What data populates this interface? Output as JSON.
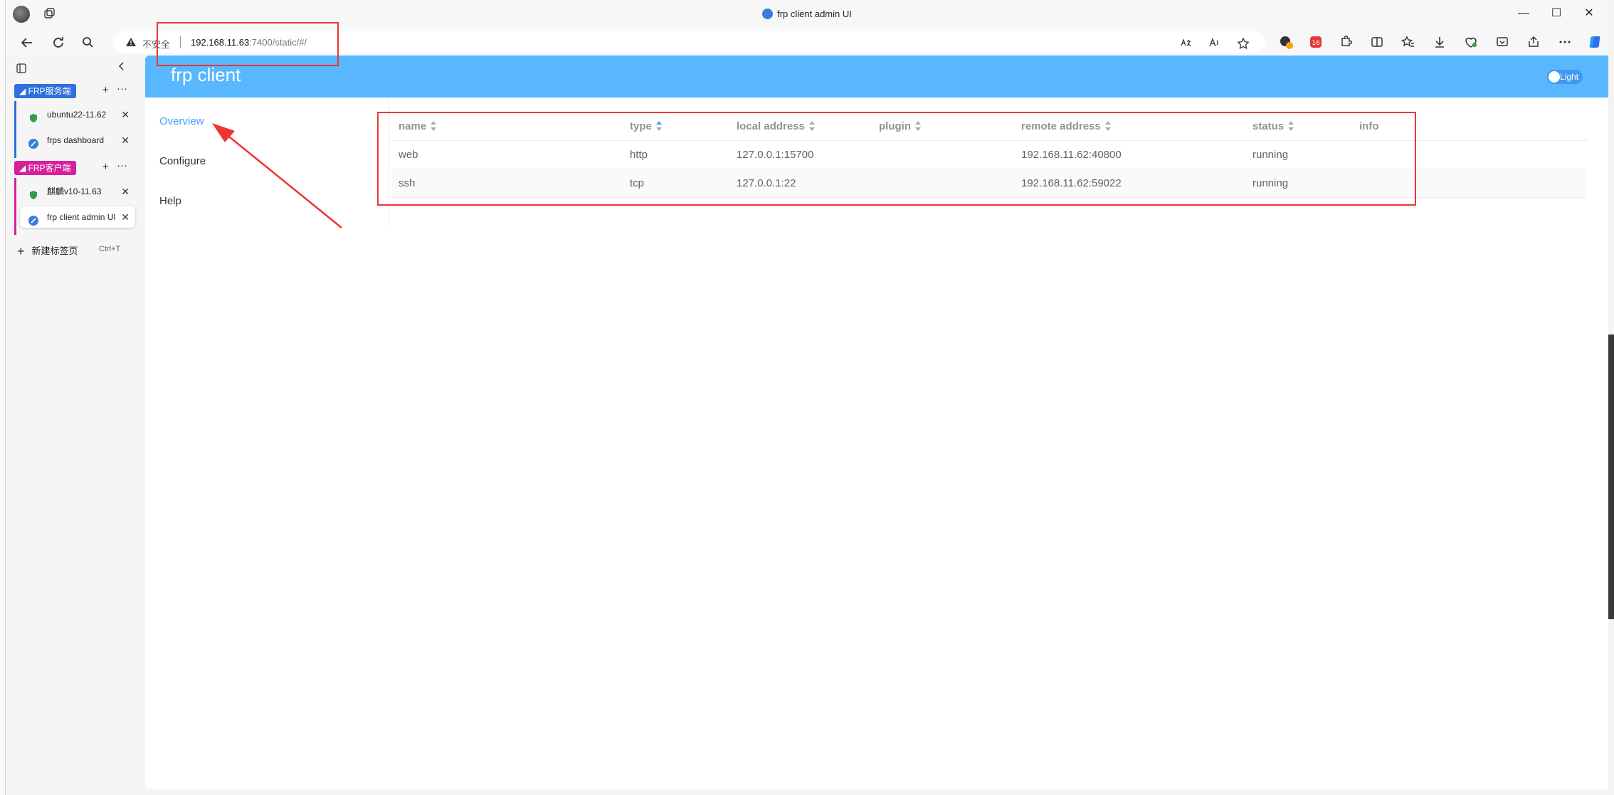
{
  "window": {
    "title": "frp client admin UI",
    "controls": [
      "—",
      "☐",
      "✕"
    ]
  },
  "address_bar": {
    "security_label": "不安全",
    "url_host": "192.168.11.63",
    "url_rest": ":7400/static/#/"
  },
  "sidebar": {
    "groups": [
      {
        "label": "FRP服务端",
        "color": "#2f6fde",
        "tabs": [
          {
            "label": "ubuntu22-11.62",
            "icon": "shield-icon"
          },
          {
            "label": "frps dashboard",
            "icon": "globe-icon"
          }
        ]
      },
      {
        "label": "FRP客户端",
        "color": "#d6219e",
        "tabs": [
          {
            "label": "麒麟v10-11.63",
            "icon": "shield-icon"
          },
          {
            "label": "frp client admin UI",
            "icon": "globe-icon"
          }
        ]
      }
    ],
    "new_tab": {
      "label": "新建标签页",
      "shortcut": "Ctrl+T"
    }
  },
  "app": {
    "title": "frp client",
    "theme_toggle": "Light",
    "accent": "#58b7ff",
    "menu": [
      "Overview",
      "Configure",
      "Help"
    ]
  },
  "table": {
    "columns": [
      "name",
      "type",
      "local address",
      "plugin",
      "remote address",
      "status",
      "info"
    ],
    "rows": [
      {
        "name": "web",
        "type": "http",
        "local_address": "127.0.0.1:15700",
        "plugin": "",
        "remote_address": "192.168.11.62:40800",
        "status": "running",
        "info": ""
      },
      {
        "name": "ssh",
        "type": "tcp",
        "local_address": "127.0.0.1:22",
        "plugin": "",
        "remote_address": "192.168.11.62:59022",
        "status": "running",
        "info": ""
      }
    ]
  }
}
